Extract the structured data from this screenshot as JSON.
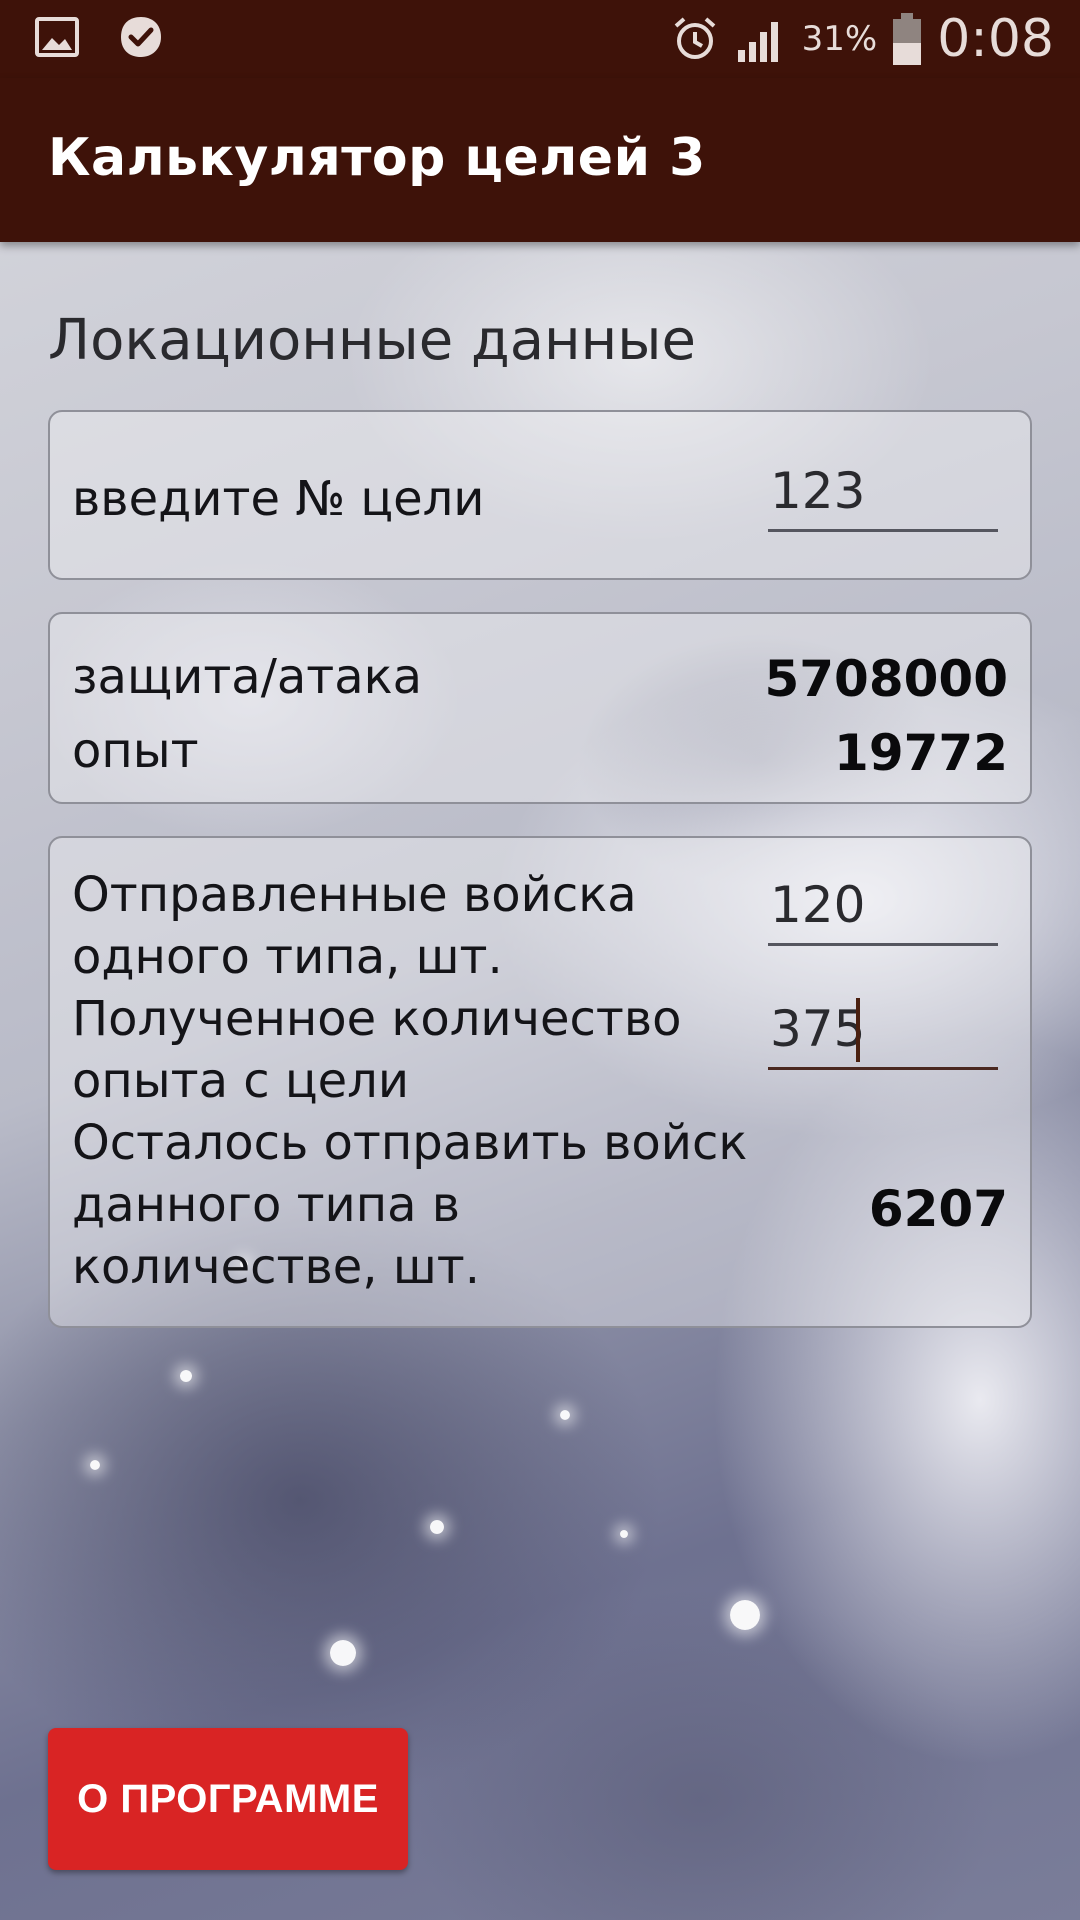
{
  "status_bar": {
    "icons_left": [
      "gallery-icon",
      "check-badge-icon"
    ],
    "icons_right": [
      "alarm-icon",
      "signal-icon",
      "battery-icon"
    ],
    "battery_percent": "31%",
    "time": "0:08"
  },
  "app_bar": {
    "title": "Калькулятор целей 3"
  },
  "section": {
    "title": "Локационные данные"
  },
  "target_card": {
    "label": "введите № цели",
    "value": "123"
  },
  "stats_card": {
    "defense_label": "защита/атака",
    "defense_value": "5708000",
    "exp_label": "опыт",
    "exp_value": "19772"
  },
  "troops_card": {
    "sent_label_1": "Отправленные войска",
    "sent_label_2": "одного типа, шт.",
    "sent_value": "120",
    "received_label_1": "Полученное количество",
    "received_label_2": "опыта с цели",
    "received_value": "375",
    "remaining_label_1": "Осталось отправить войск",
    "remaining_label_2": "данного типа в",
    "remaining_label_3": "количестве, шт.",
    "remaining_value": "6207"
  },
  "about_button": {
    "label": "О ПРОГРАММЕ"
  },
  "colors": {
    "app_bar": "#3e1209",
    "button": "#d92424",
    "card_border": "#8f9099"
  }
}
